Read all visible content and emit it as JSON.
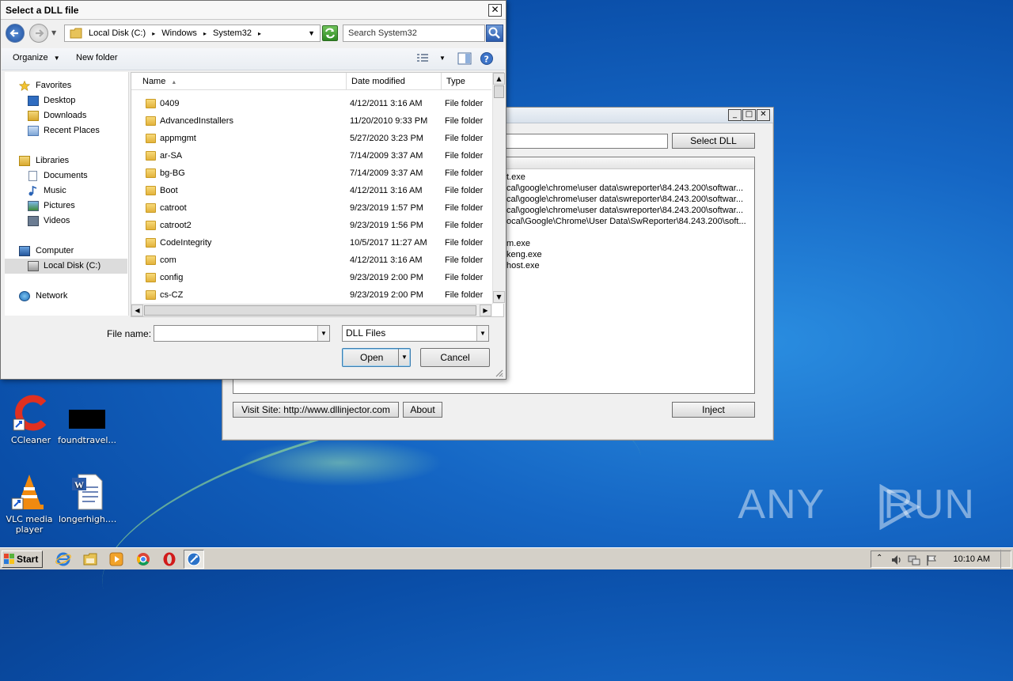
{
  "desktop": {
    "icons": [
      {
        "label": "CCleaner"
      },
      {
        "label": "foundtravel..."
      },
      {
        "label": "VLC media player"
      },
      {
        "label": "longerhigh.rtf"
      }
    ],
    "watermark": "ANY RUN"
  },
  "injector": {
    "select_dll_label": "Select DLL",
    "processes": [
      "t.exe",
      "cal\\google\\chrome\\user data\\swreporter\\84.243.200\\softwar...",
      "cal\\google\\chrome\\user data\\swreporter\\84.243.200\\softwar...",
      "cal\\google\\chrome\\user data\\swreporter\\84.243.200\\softwar...",
      "ocal\\Google\\Chrome\\User Data\\SwReporter\\84.243.200\\soft...",
      "m.exe",
      "keng.exe",
      "host.exe"
    ],
    "visit_site_label": "Visit Site: http://www.dllinjector.com",
    "about_label": "About",
    "inject_label": "Inject"
  },
  "dialog": {
    "title": "Select a DLL file",
    "close_glyph": "✕",
    "breadcrumb": [
      "Local Disk (C:)",
      "Windows",
      "System32"
    ],
    "breadcrumb_sep": "▸",
    "search_placeholder": "Search System32",
    "toolbar": {
      "organize": "Organize",
      "new_folder": "New folder"
    },
    "nav": {
      "favorites": "Favorites",
      "desktop": "Desktop",
      "downloads": "Downloads",
      "recent": "Recent Places",
      "libraries": "Libraries",
      "documents": "Documents",
      "music": "Music",
      "pictures": "Pictures",
      "videos": "Videos",
      "computer": "Computer",
      "local_disk": "Local Disk (C:)",
      "network": "Network"
    },
    "columns": {
      "name": "Name",
      "date": "Date modified",
      "type": "Type"
    },
    "rows": [
      {
        "name": "0409",
        "date": "4/12/2011 3:16 AM",
        "type": "File folder"
      },
      {
        "name": "AdvancedInstallers",
        "date": "11/20/2010 9:33 PM",
        "type": "File folder"
      },
      {
        "name": "appmgmt",
        "date": "5/27/2020 3:23 PM",
        "type": "File folder"
      },
      {
        "name": "ar-SA",
        "date": "7/14/2009 3:37 AM",
        "type": "File folder"
      },
      {
        "name": "bg-BG",
        "date": "7/14/2009 3:37 AM",
        "type": "File folder"
      },
      {
        "name": "Boot",
        "date": "4/12/2011 3:16 AM",
        "type": "File folder"
      },
      {
        "name": "catroot",
        "date": "9/23/2019 1:57 PM",
        "type": "File folder"
      },
      {
        "name": "catroot2",
        "date": "9/23/2019 1:56 PM",
        "type": "File folder"
      },
      {
        "name": "CodeIntegrity",
        "date": "10/5/2017 11:27 AM",
        "type": "File folder"
      },
      {
        "name": "com",
        "date": "4/12/2011 3:16 AM",
        "type": "File folder"
      },
      {
        "name": "config",
        "date": "9/23/2019 2:00 PM",
        "type": "File folder"
      },
      {
        "name": "cs-CZ",
        "date": "9/23/2019 2:00 PM",
        "type": "File folder"
      }
    ],
    "file_name_label": "File name:",
    "file_name_value": "",
    "file_type_value": "DLL Files",
    "open_label": "Open",
    "cancel_label": "Cancel"
  },
  "taskbar": {
    "start_label": "Start",
    "clock": "10:10 AM"
  }
}
